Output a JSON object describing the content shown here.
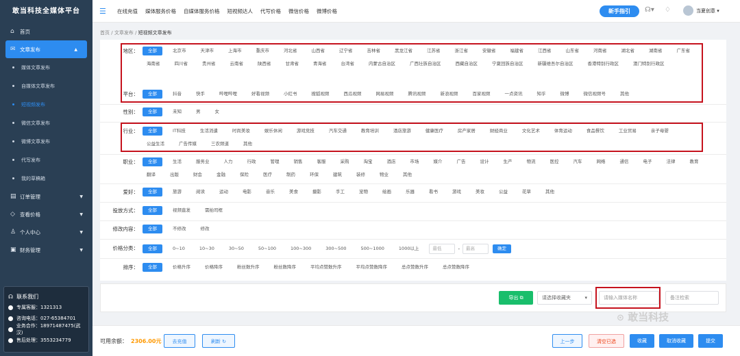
{
  "app": {
    "logo": "敢当科技全媒体平台"
  },
  "sidebar": {
    "items": [
      {
        "icon": "home-icon",
        "label": "首页"
      },
      {
        "icon": "send-icon",
        "label": "文章发布",
        "expanded": true
      }
    ],
    "subitems": [
      "媒体文章发布",
      "自媒体文章发布",
      "短视频发布",
      "微信文章发布",
      "微博文章发布",
      "代写发布",
      "我的草稿箱"
    ],
    "active_sub": 2,
    "items2": [
      {
        "icon": "order-icon",
        "label": "订单管理"
      },
      {
        "icon": "tag-icon",
        "label": "查看价格"
      },
      {
        "icon": "user-icon",
        "label": "个人中心"
      },
      {
        "icon": "finance-icon",
        "label": "财务管理"
      }
    ],
    "contact": {
      "title": "联系我们",
      "rows": [
        "专属客服：1321313",
        "咨询电话：027-65384701",
        "业务合作：18971487475(武汉)",
        "售后处理：3553234779"
      ]
    }
  },
  "topbar": {
    "nav": [
      "在线充值",
      "媒体服务价格",
      "自媒体服务价格",
      "短视频达人",
      "代写价格",
      "微信价格",
      "微博价格"
    ],
    "guide": "新手指引",
    "user": "当夏创意"
  },
  "breadcrumb": {
    "items": [
      "首页",
      "文章发布",
      "短视频文章发布"
    ]
  },
  "filters": {
    "region": {
      "label": "地区：",
      "options": [
        "全部",
        "北京市",
        "天津市",
        "上海市",
        "重庆市",
        "河北省",
        "山西省",
        "辽宁省",
        "吉林省",
        "黑龙江省",
        "江苏省",
        "浙江省",
        "安徽省",
        "福建省",
        "江西省",
        "山东省",
        "河南省",
        "湖北省",
        "湖南省",
        "广东省",
        "海南省",
        "四川省",
        "贵州省",
        "云南省",
        "陕西省",
        "甘肃省",
        "青海省",
        "台湾省",
        "内蒙古自治区",
        "广西壮族自治区",
        "西藏自治区",
        "宁夏回族自治区",
        "新疆维吾尔自治区",
        "香港特别行政区",
        "澳门特别行政区"
      ]
    },
    "platform": {
      "label": "平台：",
      "options": [
        "全部",
        "抖音",
        "快手",
        "哔哩哔哩",
        "好看视频",
        "小红书",
        "搜狐视频",
        "西瓜视频",
        "网易视频",
        "腾讯视频",
        "新浪视频",
        "百家视频",
        "一点资讯",
        "知乎",
        "微博",
        "微信视频号",
        "其他"
      ]
    },
    "gender": {
      "label": "性别：",
      "options": [
        "全部",
        "未知",
        "男",
        "女"
      ]
    },
    "industry": {
      "label": "行业：",
      "options": [
        "全部",
        "IT科技",
        "生活消遣",
        "时尚美妆",
        "娱乐休闲",
        "游戏竞技",
        "汽车交通",
        "教育培训",
        "酒店旅游",
        "健康医疗",
        "房产家居",
        "财经商业",
        "文化艺术",
        "体育运动",
        "食品餐饮",
        "工业贸易",
        "亲子母婴",
        "公益生活",
        "广告传媒",
        "三农频道",
        "其他"
      ]
    },
    "job": {
      "label": "职业：",
      "options": [
        "全部",
        "生活",
        "服务业",
        "人力",
        "行政",
        "管理",
        "销售",
        "客服",
        "采购",
        "淘宝",
        "酒店",
        "市场",
        "媒介",
        "广告",
        "设计",
        "生产",
        "物流",
        "医控",
        "汽车",
        "网络",
        "通信",
        "电子",
        "法律",
        "教育",
        "翻译",
        "出版",
        "财会",
        "金融",
        "保险",
        "医疗",
        "制药",
        "环保",
        "建筑",
        "装修",
        "物业",
        "其他"
      ]
    },
    "hobby": {
      "label": "爱好：",
      "options": [
        "全部",
        "旅游",
        "阅读",
        "运动",
        "电影",
        "音乐",
        "美食",
        "摄影",
        "手工",
        "宠物",
        "绘画",
        "乐器",
        "看书",
        "游戏",
        "美妆",
        "公益",
        "花草",
        "其他"
      ]
    },
    "delivery": {
      "label": "投放方式：",
      "options": [
        "全部",
        "视频直发",
        "需拍司框"
      ]
    },
    "modify": {
      "label": "修改内容：",
      "options": [
        "全部",
        "不修改",
        "修改"
      ]
    },
    "price": {
      "label": "价格分类：",
      "options": [
        "全部",
        "0~10",
        "10~30",
        "30~50",
        "50~100",
        "100~300",
        "300~500",
        "500~1000",
        "1000以上"
      ],
      "min_placeholder": "最低",
      "max_placeholder": "最高",
      "sep": "-",
      "confirm": "确定"
    },
    "sort": {
      "label": "排序：",
      "options": [
        "全部",
        "价格升序",
        "价格降序",
        "粉丝数升序",
        "粉丝数降序",
        "平均点赞数升序",
        "平均点赞数降序",
        "总点赞数升序",
        "总点赞数降序"
      ]
    }
  },
  "actions": {
    "export": "导出",
    "favorites": "请选择收藏夹",
    "media_name_placeholder": "请输入媒体名称",
    "note_placeholder": "备注检索"
  },
  "footer": {
    "balance_label": "可用余额：",
    "balance": "2306.00元",
    "recharge": "去充值",
    "refresh": "刷新",
    "prev": "上一步",
    "clear": "清空已选",
    "collect": "收藏",
    "uncollect": "取消收藏",
    "submit": "提交"
  },
  "watermark": "敢当科技",
  "colors": {
    "primary": "#2d8cf0",
    "sidebar": "#2a3f54",
    "highlight_box": "#c5111c",
    "success": "#19be6b",
    "balance": "#ff9900"
  }
}
